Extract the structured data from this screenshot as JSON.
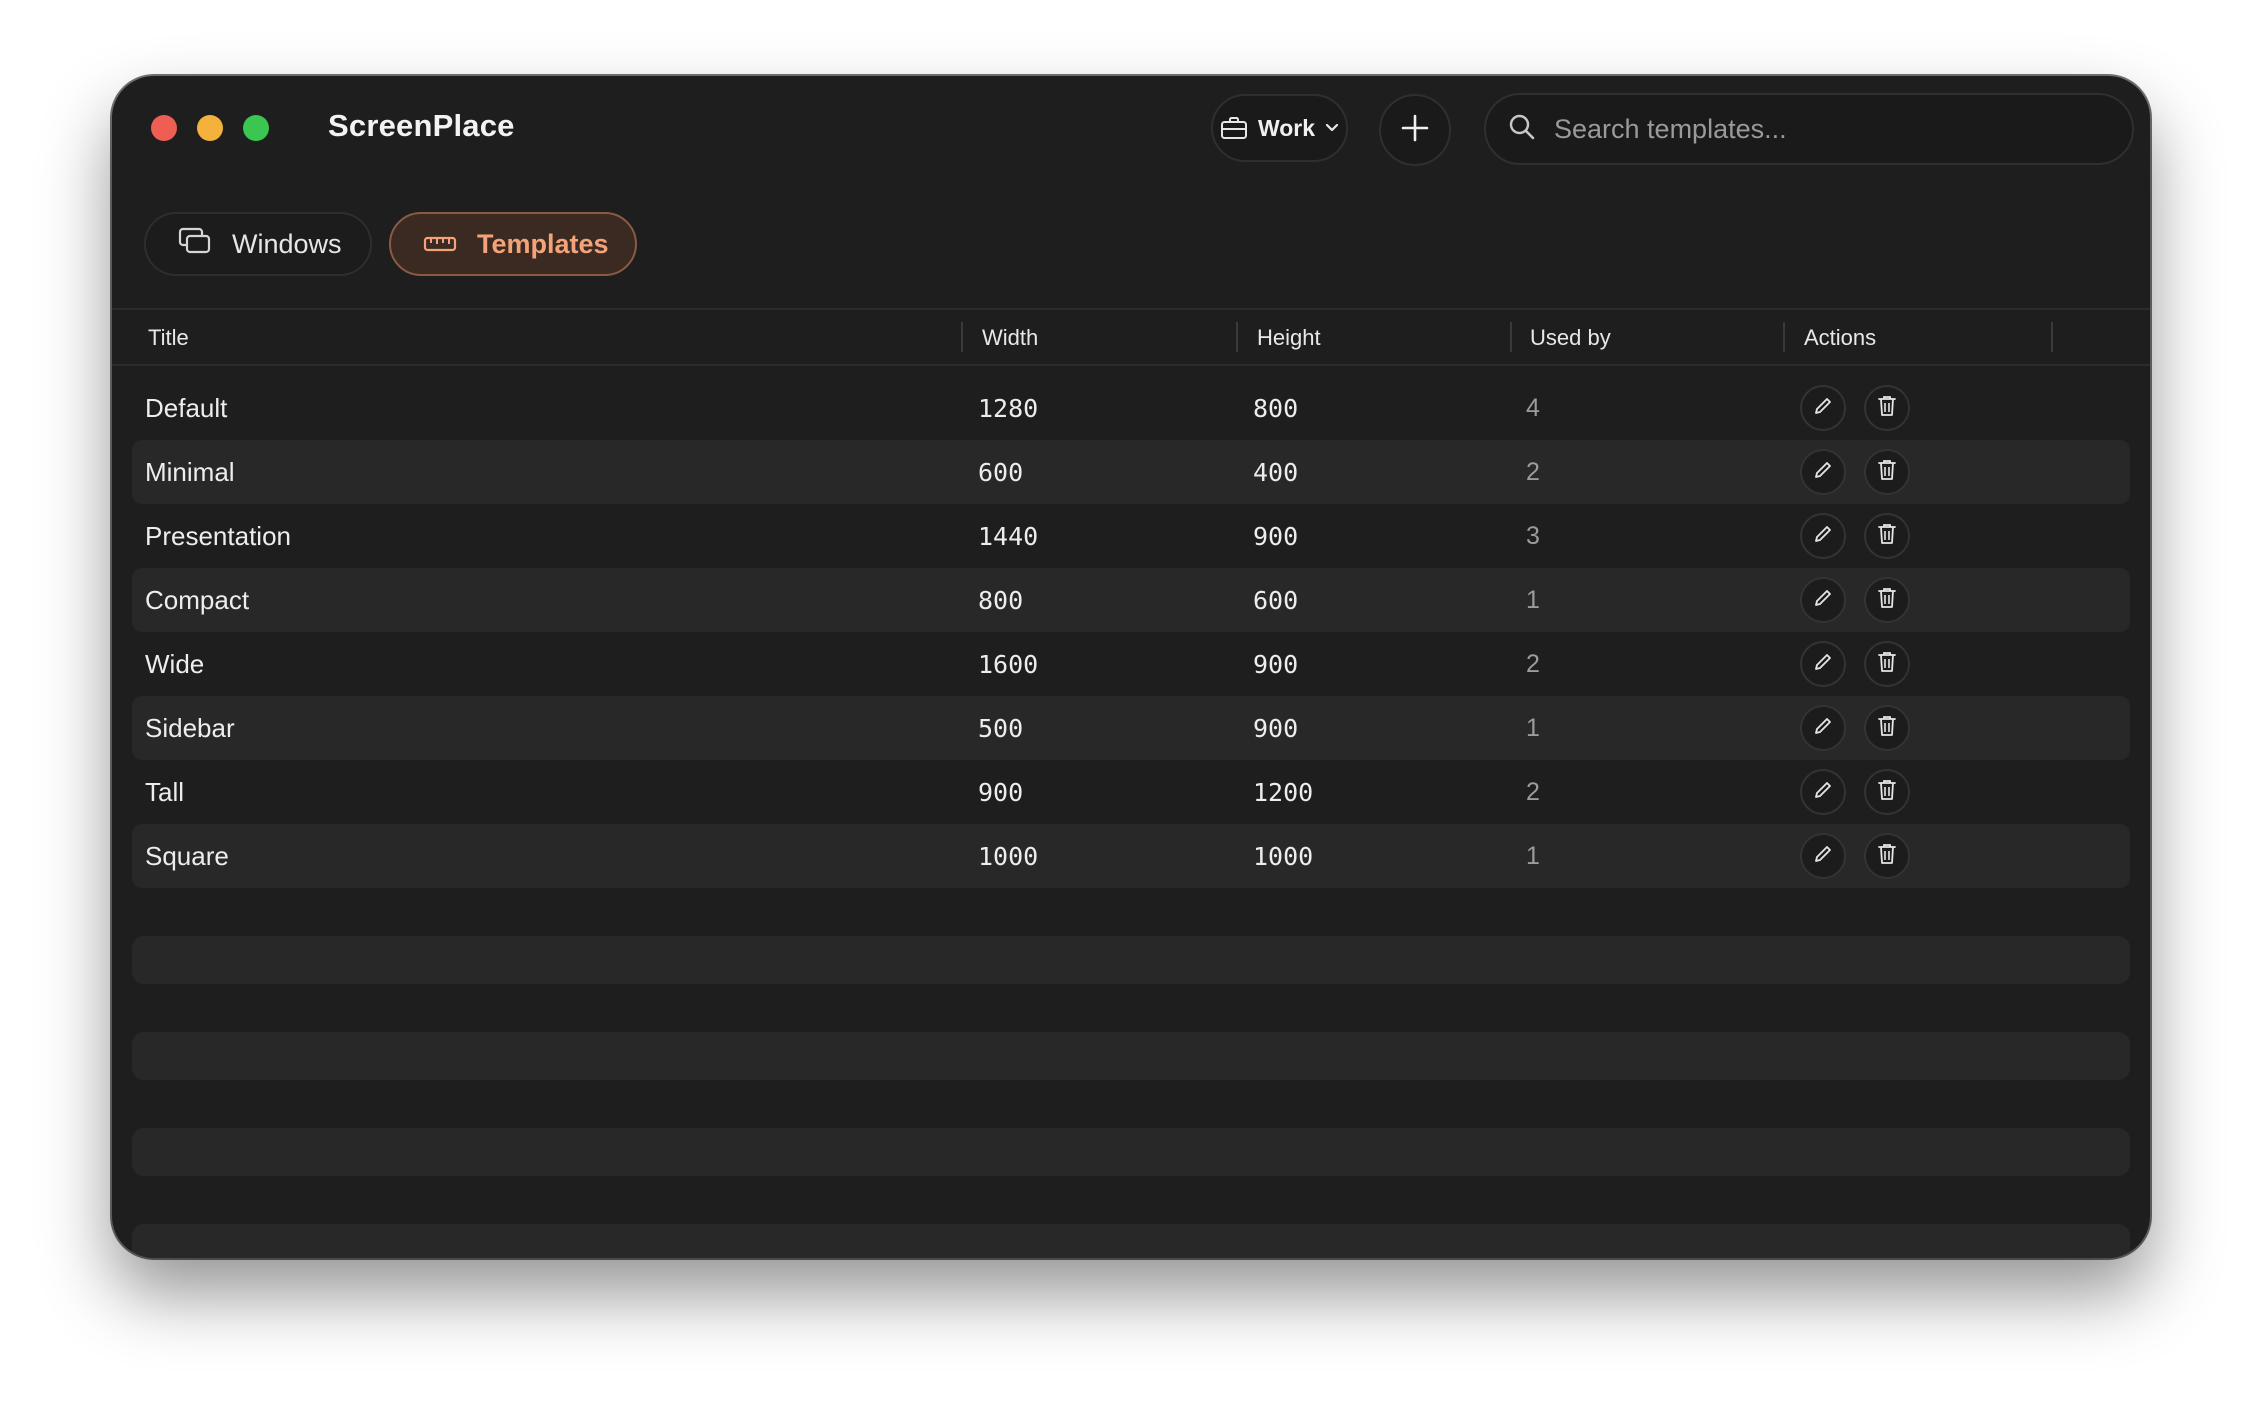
{
  "app": {
    "title": "ScreenPlace"
  },
  "toolbar": {
    "workspace_label": "Work",
    "search_placeholder": "Search templates..."
  },
  "tabs": [
    {
      "label": "Windows",
      "icon": "windows-icon",
      "selected": false
    },
    {
      "label": "Templates",
      "icon": "ruler-icon",
      "selected": true
    }
  ],
  "table": {
    "columns": [
      "Title",
      "Width",
      "Height",
      "Used by",
      "Actions"
    ],
    "rows": [
      {
        "title": "Default",
        "width": "1280",
        "height": "800",
        "used_by": "4"
      },
      {
        "title": "Minimal",
        "width": "600",
        "height": "400",
        "used_by": "2"
      },
      {
        "title": "Presentation",
        "width": "1440",
        "height": "900",
        "used_by": "3"
      },
      {
        "title": "Compact",
        "width": "800",
        "height": "600",
        "used_by": "1"
      },
      {
        "title": "Wide",
        "width": "1600",
        "height": "900",
        "used_by": "2"
      },
      {
        "title": "Sidebar",
        "width": "500",
        "height": "900",
        "used_by": "1"
      },
      {
        "title": "Tall",
        "width": "900",
        "height": "1200",
        "used_by": "2"
      },
      {
        "title": "Square",
        "width": "1000",
        "height": "1000",
        "used_by": "1"
      }
    ]
  },
  "colors": {
    "accent": "#f3a37a",
    "background": "#1e1e1e",
    "row_alt": "#282828"
  }
}
